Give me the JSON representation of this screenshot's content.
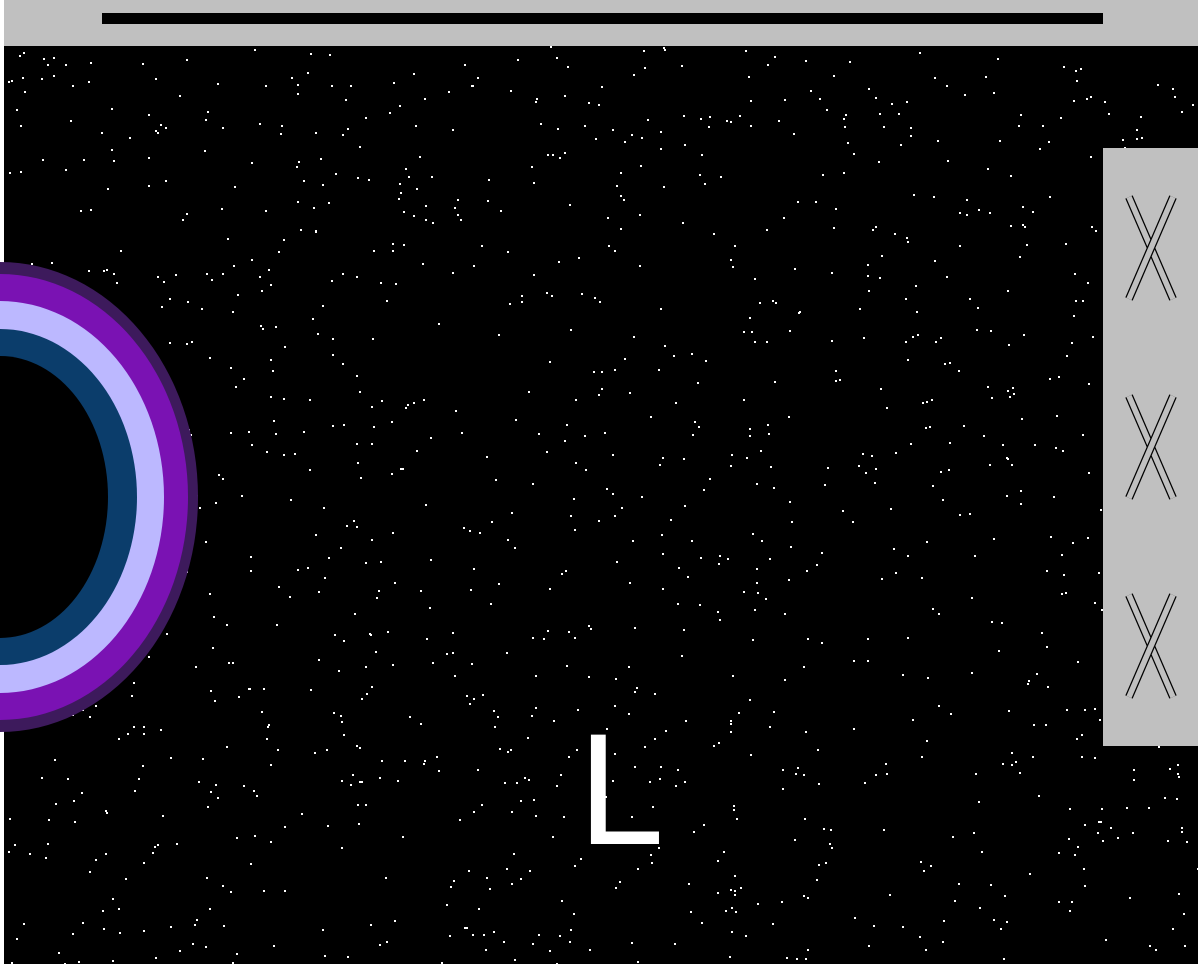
{
  "top_bar": {
    "progress_fraction": 1.0,
    "bar_color": "#000000",
    "background_color": "#c0c0c0"
  },
  "playfield": {
    "background_color": "#000000",
    "star_color": "#ffffff"
  },
  "portal": {
    "icon": "ring-portal",
    "ring_colors": [
      "#3d1a5c",
      "#7a12b3",
      "#bcb8ff",
      "#0b3d6b"
    ]
  },
  "lives_panel": {
    "background_color": "#c0c0c0",
    "lives": [
      {
        "icon": "x-mark-icon"
      },
      {
        "icon": "x-mark-icon"
      },
      {
        "icon": "x-mark-icon"
      }
    ]
  },
  "target": {
    "letter": "L",
    "color": "#ffffff"
  }
}
